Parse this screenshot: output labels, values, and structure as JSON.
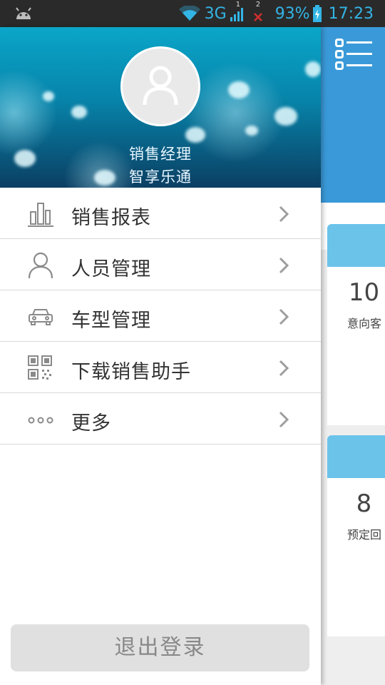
{
  "status_bar": {
    "network": "3G",
    "sim_indicator_1": "1",
    "sim_indicator_2": "2",
    "battery_percent": "93%",
    "time": "17:23"
  },
  "drawer": {
    "header": {
      "role": "销售经理",
      "app_name": "智享乐通"
    },
    "menu": [
      {
        "label": "销售报表",
        "icon": "bar-chart-icon"
      },
      {
        "label": "人员管理",
        "icon": "person-icon"
      },
      {
        "label": "车型管理",
        "icon": "car-icon"
      },
      {
        "label": "下载销售助手",
        "icon": "qr-code-icon"
      },
      {
        "label": "更多",
        "icon": "more-icon"
      }
    ],
    "logout_label": "退出登录"
  },
  "main": {
    "cards": [
      {
        "value": "10",
        "label": "意向客"
      },
      {
        "value": "8",
        "label": "预定回"
      }
    ]
  },
  "colors": {
    "status_bar": "#2a2a2a",
    "status_accent": "#33b5e5",
    "main_header": "#3a9ad9",
    "card_top": "#6bc3ea",
    "logout_bg": "#e0e0e0"
  }
}
